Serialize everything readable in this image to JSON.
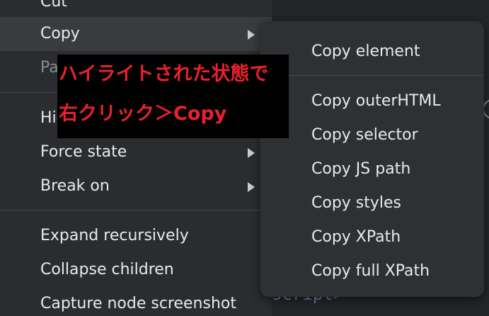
{
  "main_menu": {
    "items": [
      {
        "label": "Cut",
        "state": "normal"
      },
      {
        "label": "Copy",
        "state": "highlighted",
        "has_submenu": true
      },
      {
        "label": "Paste",
        "state": "disabled"
      },
      {
        "label": "Hide element",
        "state": "normal"
      },
      {
        "label": "Force state",
        "state": "normal",
        "has_submenu": true
      },
      {
        "label": "Break on",
        "state": "normal",
        "has_submenu": true
      },
      {
        "label": "Expand recursively",
        "state": "normal"
      },
      {
        "label": "Collapse children",
        "state": "normal"
      },
      {
        "label": "Capture node screenshot",
        "state": "normal"
      }
    ]
  },
  "submenu": {
    "items": [
      {
        "label": "Copy element"
      },
      {
        "label": "Copy outerHTML"
      },
      {
        "label": "Copy selector"
      },
      {
        "label": "Copy JS path"
      },
      {
        "label": "Copy styles"
      },
      {
        "label": "Copy XPath"
      },
      {
        "label": "Copy full XPath"
      }
    ]
  },
  "annotation": {
    "line1": "ハイライトされた状態で",
    "line2": "右クリック＞Copy",
    "text_color": "#e8212b",
    "background": "#000000"
  },
  "background_panel": {
    "fragment_script": "script>"
  },
  "colors": {
    "menu_bg": "#2b2c2f",
    "submenu_bg": "#2f3034",
    "highlight_bg": "#3a3b3f",
    "text": "#e8eaed",
    "disabled_text": "#8a8c90"
  }
}
